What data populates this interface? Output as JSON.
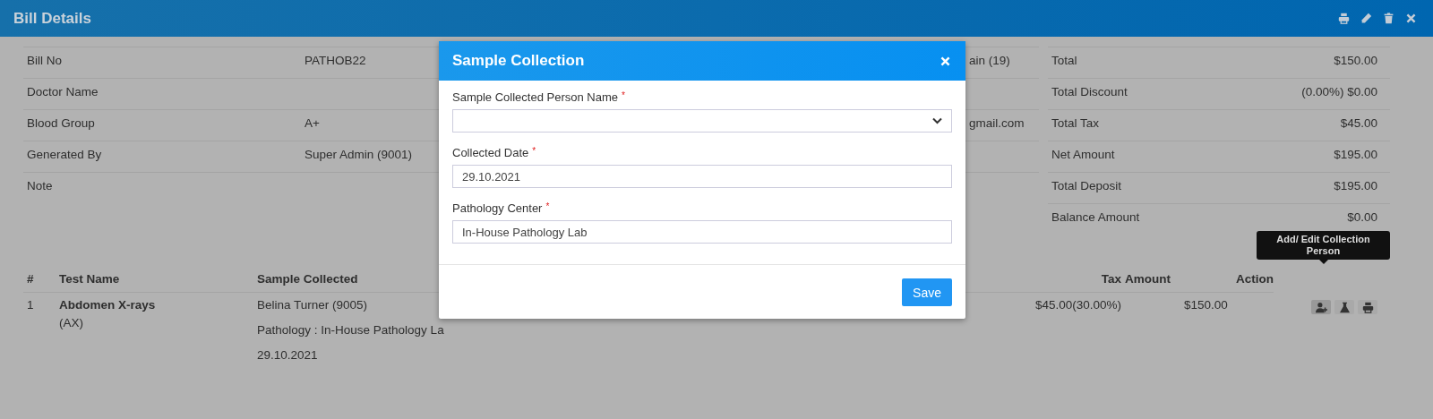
{
  "page_header": {
    "title": "Bill Details",
    "actions": [
      {
        "kind": "print"
      },
      {
        "kind": "edit"
      },
      {
        "kind": "delete"
      },
      {
        "kind": "close"
      }
    ]
  },
  "details": [
    {
      "label": "Bill No",
      "value": "PATHOB22",
      "column_3": "ain (19)"
    },
    {
      "label": "Doctor Name"
    },
    {
      "label": "Blood Group",
      "value": "A+",
      "column_3": "gmail.com"
    },
    {
      "label": "Generated By",
      "value": "Super Admin (9001)"
    },
    {
      "label": "Note"
    }
  ],
  "summary": [
    {
      "label": "Total",
      "value": "$150.00"
    },
    {
      "label": "Total Discount",
      "value": "(0.00%) $0.00"
    },
    {
      "label": "Total Tax",
      "value": "$45.00"
    },
    {
      "label": "Net Amount",
      "value": "$195.00"
    },
    {
      "label": "Total Deposit",
      "value": "$195.00"
    },
    {
      "label": "Balance Amount",
      "value": "$0.00"
    }
  ],
  "tests": {
    "columns": [
      "#",
      "Test Name",
      "Sample Collected",
      "Tax",
      "Amount",
      "Action"
    ],
    "rows": [
      {
        "number": "1",
        "test_name": "Abdomen X-rays",
        "test_code": "(AX)",
        "collected_by": "Belina Turner (9005)",
        "pathology": "Pathology : In-House Pathology La",
        "date": "29.10.2021",
        "tax": "$45.00(30.00%)",
        "amount": "$150.00",
        "actions": [
          {
            "kind": "add_person",
            "selected": true
          },
          {
            "kind": "flask",
            "selected": false
          },
          {
            "kind": "print",
            "selected": false
          }
        ]
      }
    ]
  },
  "tooltip": "Add/ Edit Collection Person",
  "modal": {
    "title": "Sample Collection",
    "fields": [
      {
        "kind": "select",
        "label": "Sample Collected Person Name",
        "required_mark": "*"
      },
      {
        "kind": "input",
        "label": "Collected Date",
        "required_mark": "*",
        "value": "29.10.2021"
      },
      {
        "kind": "input",
        "label": "Pathology Center",
        "required_mark": "*",
        "value": "In-House Pathology Lab"
      }
    ],
    "save_button": "Save"
  }
}
